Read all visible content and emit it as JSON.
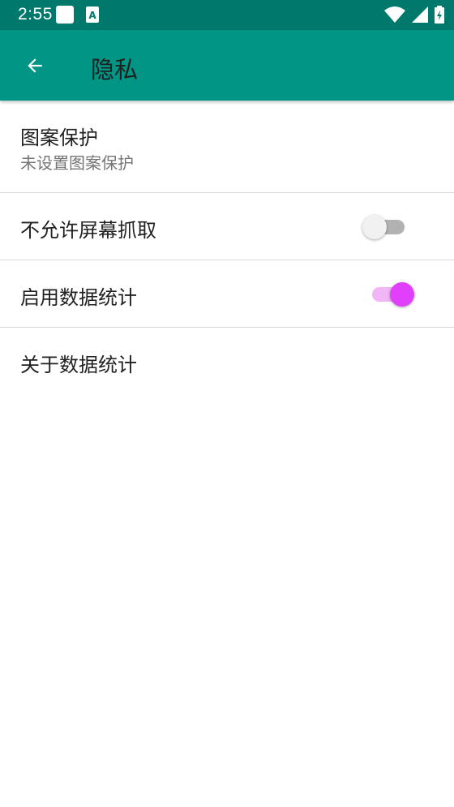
{
  "status_bar": {
    "time": "2:55",
    "notif_icons": [
      "square-notification-icon",
      "a-app-notification-icon"
    ],
    "right_icons": [
      "wifi-icon",
      "cell-signal-icon",
      "battery-icon"
    ],
    "background": "#00786b"
  },
  "app_bar": {
    "title": "隐私",
    "background": "#009584",
    "back_icon": "arrow-back-icon"
  },
  "settings": {
    "pattern_lock": {
      "title": "图案保护",
      "summary": "未设置图案保护"
    },
    "disallow_screenshot": {
      "title": "不允许屏幕抓取",
      "enabled": false
    },
    "enable_analytics": {
      "title": "启用数据统计",
      "enabled": true,
      "accent": "#e040fb"
    },
    "about_analytics": {
      "title": "关于数据统计"
    }
  }
}
